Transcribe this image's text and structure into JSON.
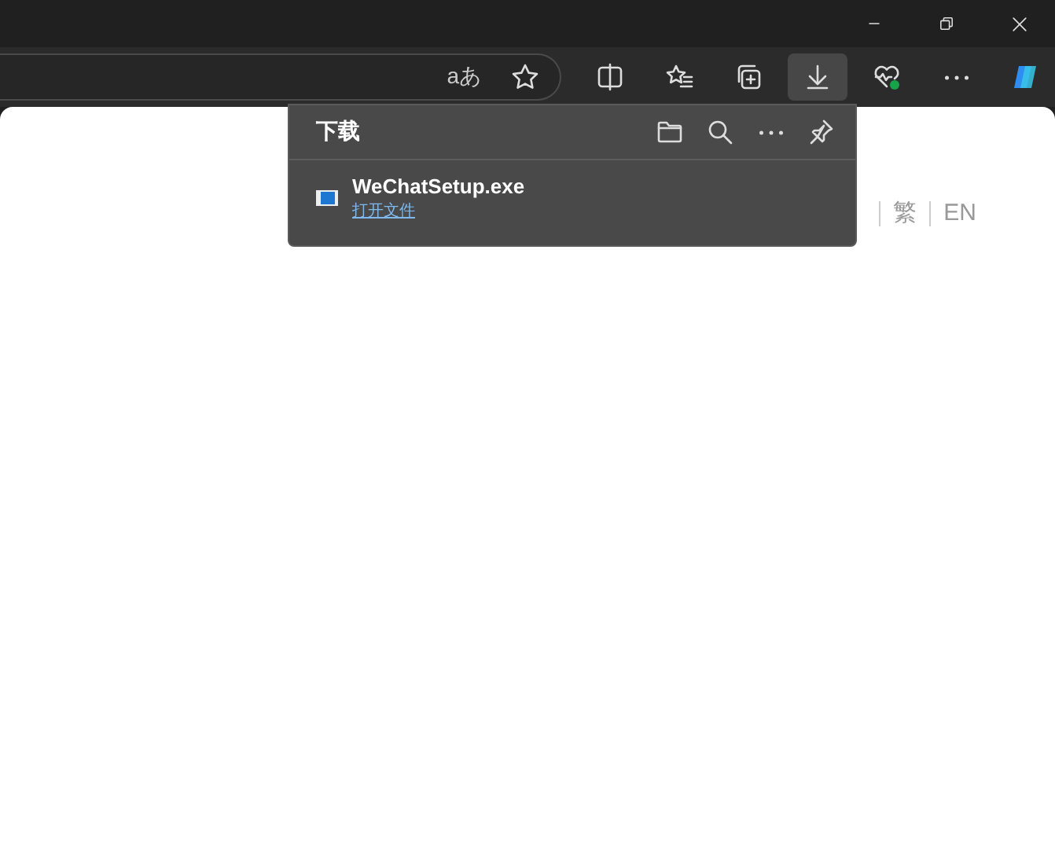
{
  "address_bar": {
    "translate_label": "aあ"
  },
  "toolbar": [
    {
      "kind": "split",
      "selected": false
    },
    {
      "kind": "favorites",
      "selected": false
    },
    {
      "kind": "collections",
      "selected": false
    },
    {
      "kind": "downloads",
      "selected": true
    },
    {
      "kind": "health",
      "selected": false
    },
    {
      "kind": "more",
      "selected": false
    },
    {
      "kind": "copilot",
      "selected": false
    }
  ],
  "downloads_panel": {
    "title": "下载",
    "items": [
      {
        "file_name": "WeChatSetup.exe",
        "action": "打开文件"
      }
    ]
  },
  "language_links": [
    "繁",
    "EN"
  ]
}
